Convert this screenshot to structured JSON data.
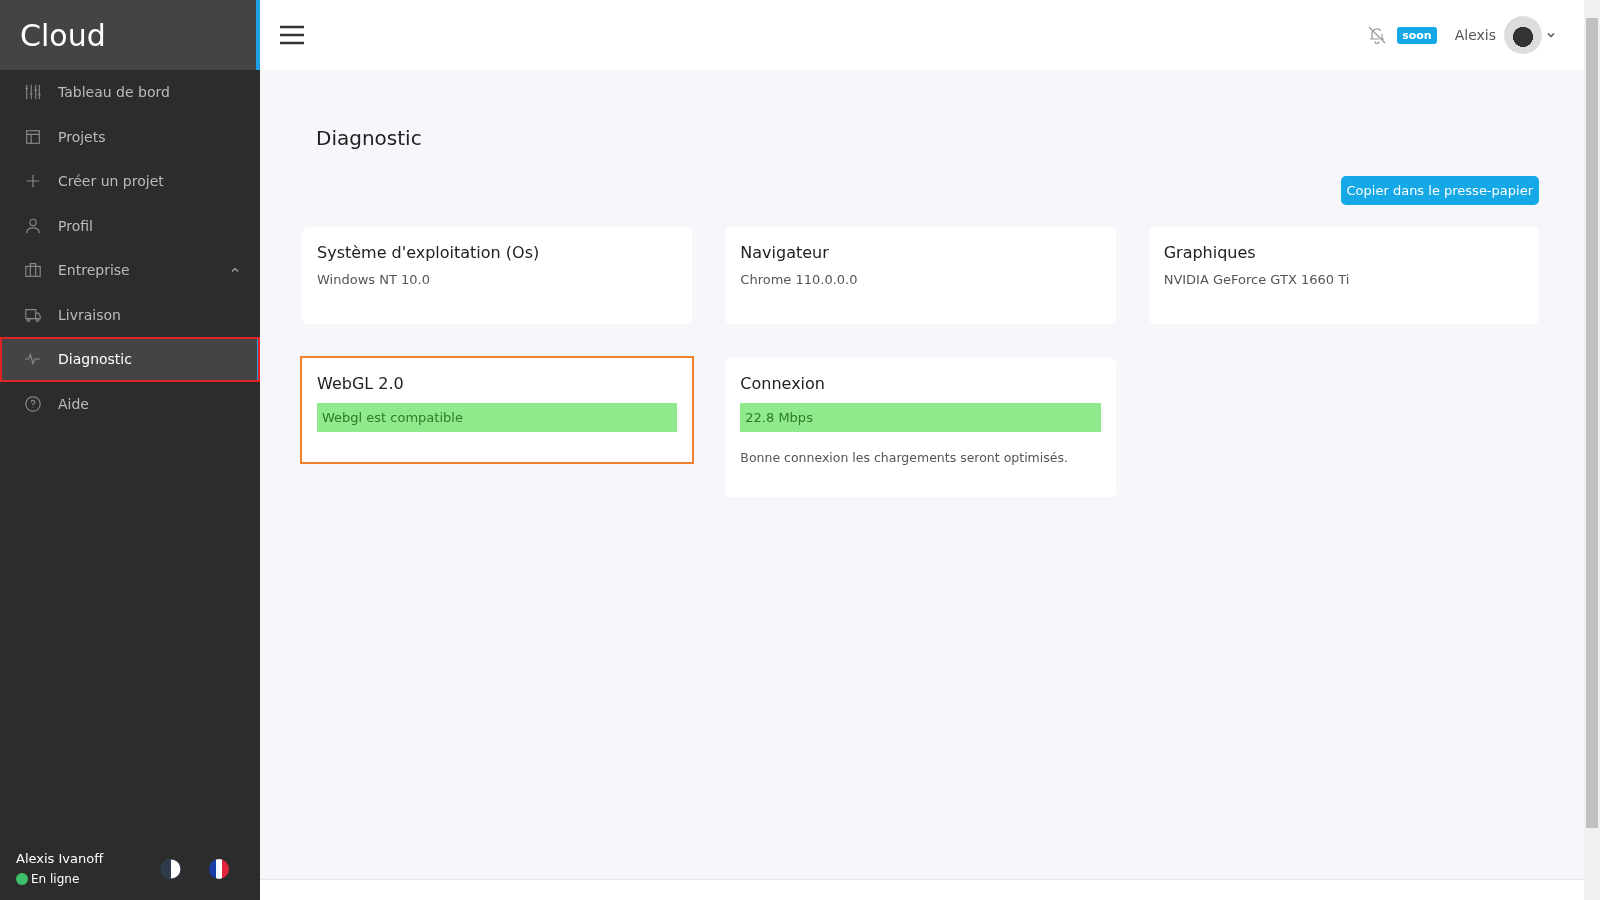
{
  "sidebar": {
    "logo": "Cloud",
    "items": [
      {
        "label": "Tableau de bord",
        "selected": false,
        "outlined": false
      },
      {
        "label": "Projets",
        "selected": false,
        "outlined": false
      },
      {
        "label": "Créer un projet",
        "selected": false,
        "outlined": false
      },
      {
        "label": "Profil",
        "selected": false,
        "outlined": false
      },
      {
        "label": "Entreprise",
        "selected": false,
        "outlined": false,
        "expanded": true
      },
      {
        "label": "Livraison",
        "selected": false,
        "outlined": false
      },
      {
        "label": "Diagnostic",
        "selected": true,
        "outlined": true
      },
      {
        "label": "Aide",
        "selected": false,
        "outlined": false
      }
    ],
    "user": {
      "name": "Alexis Ivanoff",
      "status": "En ligne",
      "online": true
    }
  },
  "header": {
    "badge": "soon",
    "username": "Alexis"
  },
  "page": {
    "title": "Diagnostic",
    "copy_button": "Copier dans le presse-papier",
    "cards": [
      {
        "kind": "info",
        "title": "Système d'exploitation (Os)",
        "value": "Windows NT 10.0",
        "outlined": false
      },
      {
        "kind": "info",
        "title": "Navigateur",
        "value": "Chrome 110.0.0.0",
        "outlined": false
      },
      {
        "kind": "info",
        "title": "Graphiques",
        "value": "NVIDIA GeForce GTX 1660 Ti",
        "outlined": false
      },
      {
        "kind": "status",
        "title": "WebGL 2.0",
        "value": "Webgl est compatible",
        "ok": true,
        "outlined": true
      },
      {
        "kind": "status",
        "title": "Connexion",
        "value": "22.8 Mbps",
        "ok": true,
        "note": "Bonne connexion les chargements seront optimisés.",
        "outlined": false
      }
    ]
  }
}
